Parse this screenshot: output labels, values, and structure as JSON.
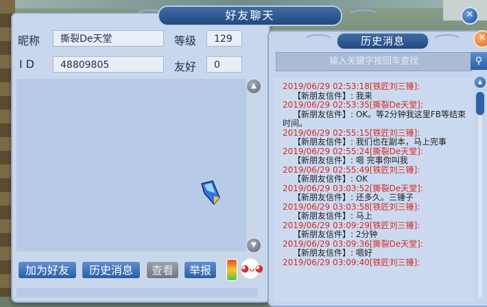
{
  "chat_window": {
    "title": "好友聊天",
    "nickname_label": "昵称",
    "nickname_value": "撕裂De天堂",
    "level_label": "等级",
    "level_value": "129",
    "id_label": "I D",
    "id_value": "48809805",
    "friendship_label": "友好",
    "friendship_value": "0",
    "buttons": {
      "add_friend": "加为好友",
      "history": "历史消息",
      "view": "查看",
      "report": "举报"
    }
  },
  "history_window": {
    "title": "历史消息",
    "search_placeholder": "输入关键字按回车查找",
    "messages": [
      {
        "head": "2019/06/29 02:53:18[铁匠刘三锤]:",
        "body": "【新朋友信件】: 我来"
      },
      {
        "head": "2019/06/29 02:53:35[撕裂De天堂]:",
        "body": "【新朋友信件】: OK。等2分钟我这里FB等结束时间。"
      },
      {
        "head": "2019/06/29 02:55:15[铁匠刘三锤]:",
        "body": "【新朋友信件】: 我们也在副本，马上完事"
      },
      {
        "head": "2019/06/29 02:55:24[撕裂De天堂]:",
        "body": "【新朋友信件】: 嗯 完事你叫我"
      },
      {
        "head": "2019/06/29 02:55:49[铁匠刘三锤]:",
        "body": "【新朋友信件】: OK"
      },
      {
        "head": "2019/06/29 03:03:52[撕裂De天堂]:",
        "body": "【新朋友信件】: 还多久。三锤子"
      },
      {
        "head": "2019/06/29 03:03:58[铁匠刘三锤]:",
        "body": "【新朋友信件】: 马上"
      },
      {
        "head": "2019/06/29 03:09:29[铁匠刘三锤]:",
        "body": "【新朋友信件】: 2分钟"
      },
      {
        "head": "2019/06/29 03:09:36[撕裂De天堂]:",
        "body": "【新朋友信件】: 嗯好"
      },
      {
        "head": "2019/06/29 03:09:40[铁匠刘三锤]:",
        "body": ""
      }
    ]
  },
  "icons": {
    "close": "close-icon",
    "search": "search-icon",
    "scroll_up": "chevron-up-icon",
    "scroll_down": "chevron-down-icon"
  }
}
